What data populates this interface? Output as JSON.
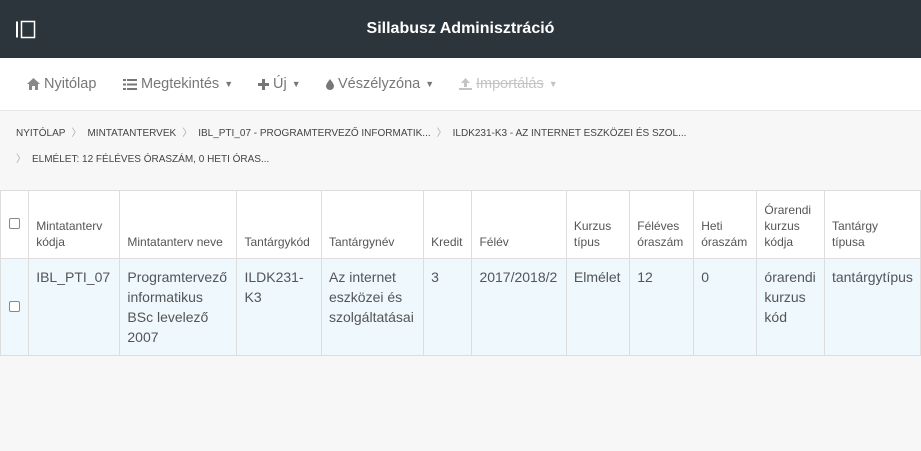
{
  "header": {
    "title": "Sillabusz Adminisztráció",
    "menu_toggle_icon": "sidebar-toggle-icon"
  },
  "menu": [
    {
      "label": "Nyitólap",
      "icon": "home-icon",
      "dropdown": false
    },
    {
      "label": "Megtekintés",
      "icon": "list-icon",
      "dropdown": true
    },
    {
      "label": "Új",
      "icon": "plus-icon",
      "dropdown": true
    },
    {
      "label": "Vészélyzóna",
      "icon": "drop-icon",
      "dropdown": true
    },
    {
      "label": "Importálás",
      "icon": "upload-icon",
      "dropdown": true,
      "disabled": true
    }
  ],
  "breadcrumb": [
    "NYITÓLAP",
    "MINTATANTERVEK",
    "IBL_PTI_07 - PROGRAMTERVEZŐ INFORMATIK...",
    "ILDK231-K3 - AZ INTERNET ESZKÖZEI ÉS SZOL...",
    "ELMÉLET: 12 FÉLÉVES ÓRASZÁM, 0 HETI ÓRAS..."
  ],
  "table": {
    "headers": [
      "Mintatanterv kódja",
      "Mintatanterv neve",
      "Tantárgykód",
      "Tantárgynév",
      "Kredit",
      "Félév",
      "Kurzus típus",
      "Féléves óraszám",
      "Heti óraszám",
      "Órarendi kurzus kódja",
      "Tantárgy típusa"
    ],
    "rows": [
      [
        "IBL_PTI_07",
        "Programtervező informatikus BSc levelező 2007",
        "ILDK231-K3",
        "Az internet eszközei és szolgáltatásai",
        "3",
        "2017/2018/2",
        "Elmélet",
        "12",
        "0",
        "órarendi kurzus kód",
        "tantárgytípus"
      ]
    ]
  },
  "colors": {
    "topbar": "#2d353c",
    "row_selected": "#eef8fd",
    "menu_text": "#777777"
  }
}
